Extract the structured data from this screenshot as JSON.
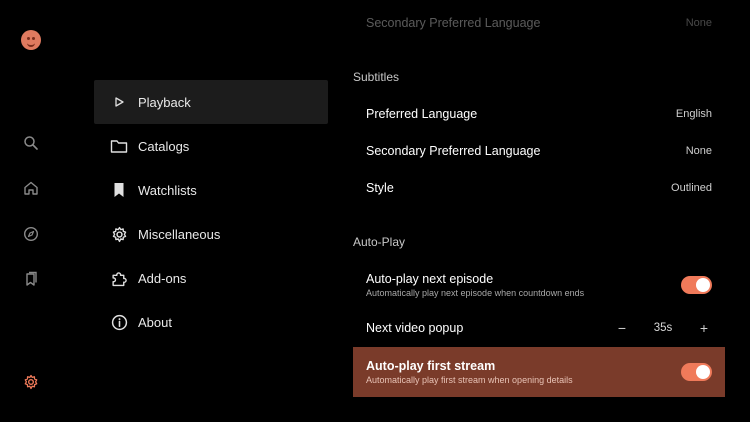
{
  "colors": {
    "accent": "#f07a5a",
    "highlight_row": "#7a3b2a",
    "active_menu_bg": "#1c1c1c"
  },
  "rail": {
    "icons": [
      "avatar",
      "search-icon",
      "home-icon",
      "compass-icon",
      "bookmarks-icon",
      "settings-icon"
    ]
  },
  "menu": {
    "items": [
      {
        "label": "Playback",
        "icon": "play-icon"
      },
      {
        "label": "Catalogs",
        "icon": "folder-icon"
      },
      {
        "label": "Watchlists",
        "icon": "bookmark-icon"
      },
      {
        "label": "Miscellaneous",
        "icon": "gear-icon"
      },
      {
        "label": "Add-ons",
        "icon": "puzzle-icon"
      },
      {
        "label": "About",
        "icon": "info-icon"
      }
    ]
  },
  "panel": {
    "top_row": {
      "label": "Secondary Preferred Language",
      "value": "None"
    },
    "subtitles": {
      "title": "Subtitles",
      "preferred_language": {
        "label": "Preferred Language",
        "value": "English"
      },
      "secondary_language": {
        "label": "Secondary Preferred Language",
        "value": "None"
      },
      "style": {
        "label": "Style",
        "value": "Outlined"
      }
    },
    "autoplay": {
      "title": "Auto-Play",
      "next_episode": {
        "label": "Auto-play next episode",
        "sub": "Automatically play next episode when countdown ends",
        "on": true
      },
      "next_popup": {
        "label": "Next video popup",
        "value": "35s",
        "minus": "−",
        "plus": "+"
      },
      "first_stream": {
        "label": "Auto-play first stream",
        "sub": "Automatically play first stream when opening details",
        "on": true
      }
    }
  }
}
